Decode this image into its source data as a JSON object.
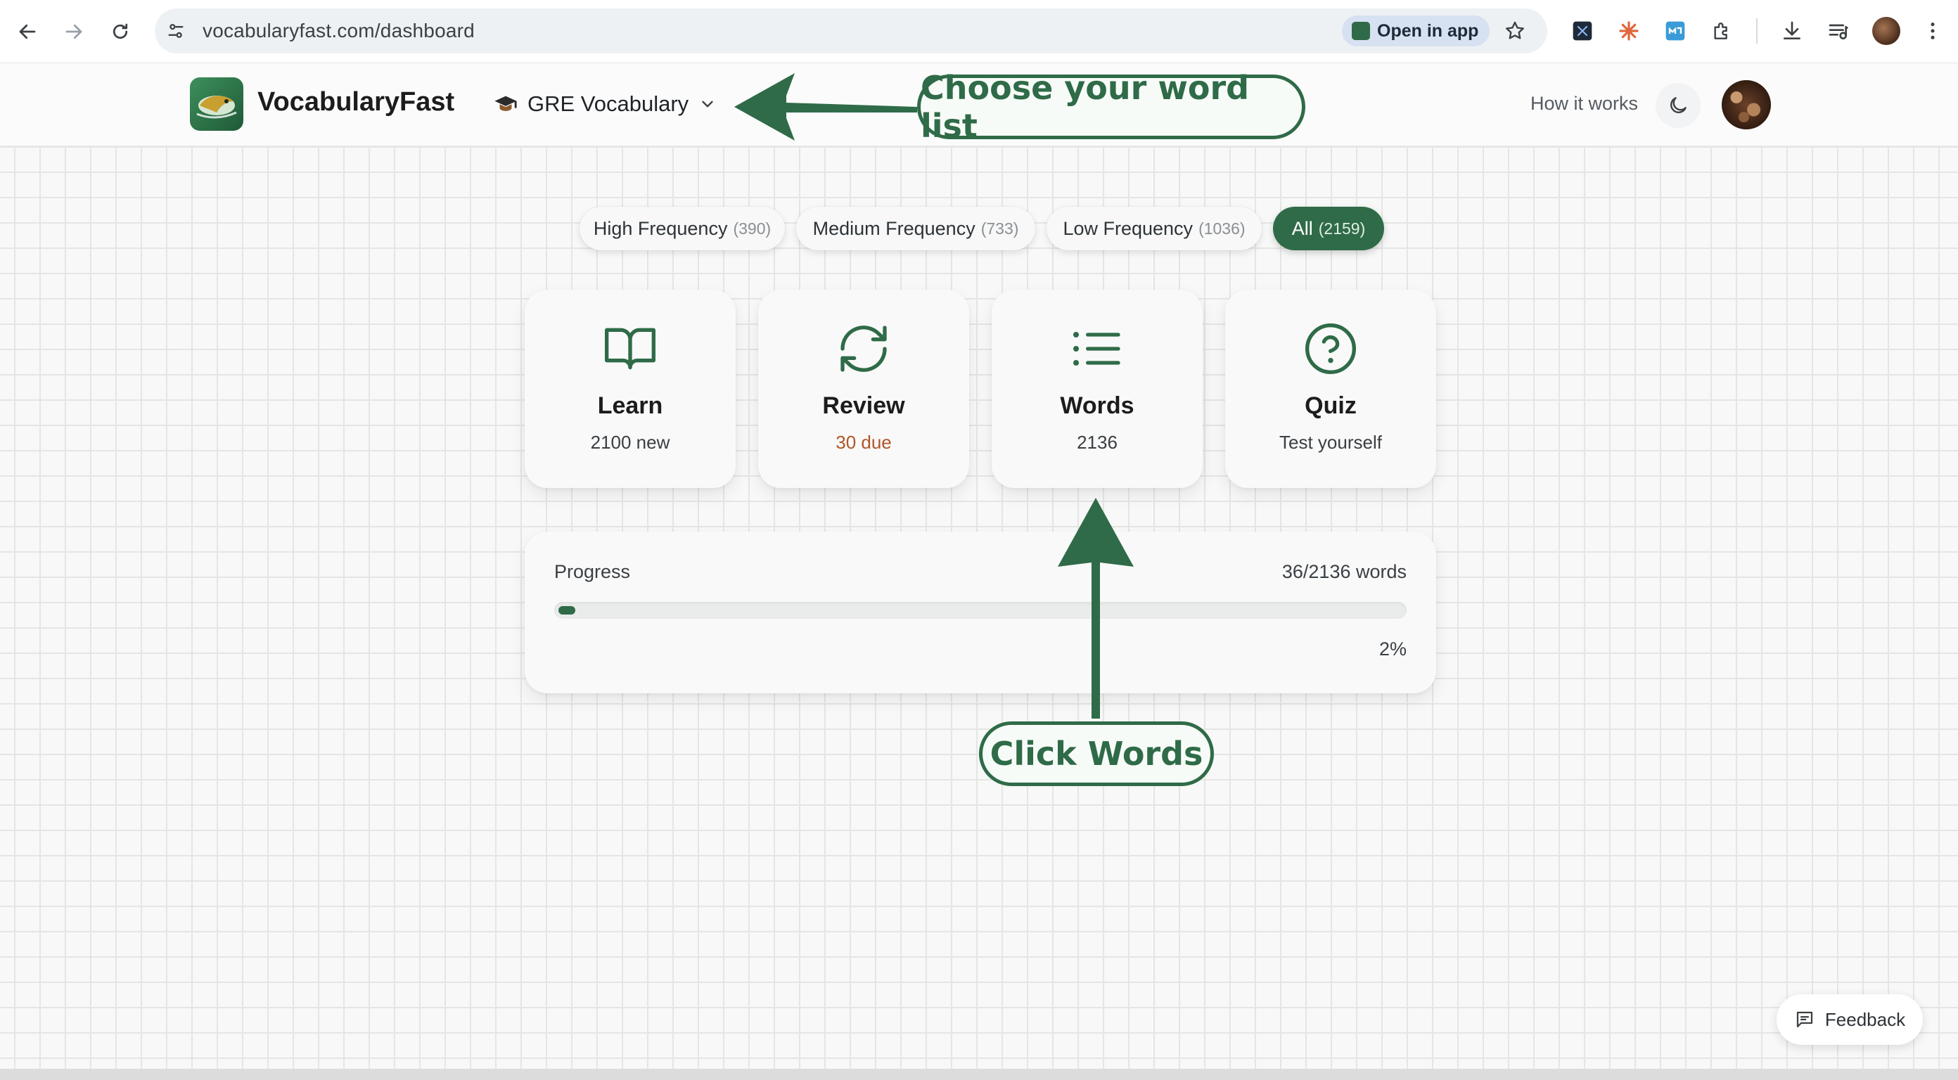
{
  "browser": {
    "url": "vocabularyfast.com/dashboard",
    "open_in_app_label": "Open in app"
  },
  "header": {
    "brand": "VocabularyFast",
    "list_selector": "GRE Vocabulary",
    "how_it_works": "How it works"
  },
  "filters": [
    {
      "label": "High Frequency",
      "count": "(390)",
      "active": false
    },
    {
      "label": "Medium Frequency",
      "count": "(733)",
      "active": false
    },
    {
      "label": "Low Frequency",
      "count": "(1036)",
      "active": false
    },
    {
      "label": "All",
      "count": "(2159)",
      "active": true
    }
  ],
  "cards": [
    {
      "title": "Learn",
      "subtitle": "2100 new",
      "icon": "book-open-icon"
    },
    {
      "title": "Review",
      "subtitle": "30 due",
      "icon": "refresh-icon"
    },
    {
      "title": "Words",
      "subtitle": "2136",
      "icon": "list-icon"
    },
    {
      "title": "Quiz",
      "subtitle": "Test yourself",
      "icon": "question-circle-icon"
    }
  ],
  "progress": {
    "label": "Progress",
    "count_text": "36/2136 words",
    "percent_text": "2%",
    "fraction": 0.017
  },
  "annotations": {
    "choose_list": "Choose your word list",
    "click_words": "Click Words"
  },
  "feedback_label": "Feedback",
  "colors": {
    "accent": "#2f6b48",
    "due": "#b0562a"
  }
}
